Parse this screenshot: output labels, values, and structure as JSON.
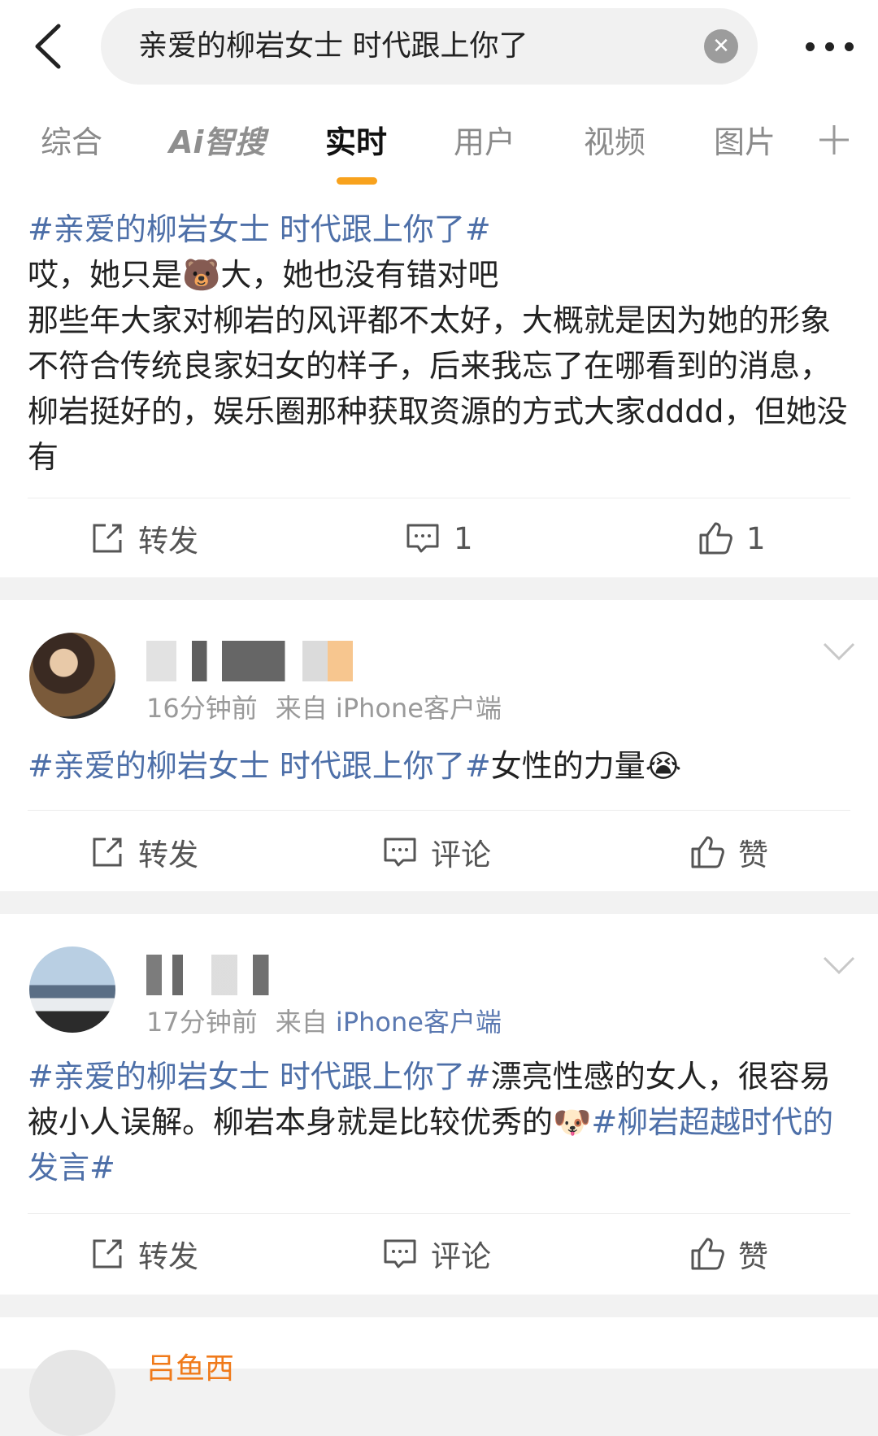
{
  "search": {
    "query": "亲爱的柳岩女士 时代跟上你了"
  },
  "tabs": [
    {
      "label": "综合"
    },
    {
      "label": "Ai智搜"
    },
    {
      "label": "实时"
    },
    {
      "label": "用户"
    },
    {
      "label": "视频"
    },
    {
      "label": "图片"
    }
  ],
  "colors": {
    "accent": "#f8a21d",
    "link": "#4d6fa8",
    "source": "#5b79b1"
  },
  "posts": [
    {
      "tag": "#亲爱的柳岩女士 时代跟上你了#",
      "line1a": "哎，她只是",
      "emoji1": "🐻",
      "line1b": "大，她也没有错对吧",
      "body": "那些年大家对柳岩的风评都不太好，大概就是因为她的形象不符合传统良家妇女的样子，后来我忘了在哪看到的消息，柳岩挺好的，娱乐圈那种获取资源的方式大家dddd，但她没有",
      "repost": "转发",
      "comments": "1",
      "likes": "1"
    },
    {
      "time": "16分钟前",
      "source_prefix": "来自",
      "client": "iPhone客户端",
      "tag": "#亲爱的柳岩女士 时代跟上你了#",
      "text": "女性的力量",
      "emoji": "😭",
      "repost": "转发",
      "comment": "评论",
      "like": "赞"
    },
    {
      "time": "17分钟前",
      "source_prefix": "来自",
      "client": "iPhone客户端",
      "tag": "#亲爱的柳岩女士 时代跟上你了#",
      "text": "漂亮性感的女人，很容易被小人误解。柳岩本身就是比较优秀的",
      "emoji": "🐶",
      "tag2": "#柳岩超越时代的发言#",
      "repost": "转发",
      "comment": "评论",
      "like": "赞"
    }
  ],
  "partial_user": {
    "name": "吕鱼西"
  }
}
